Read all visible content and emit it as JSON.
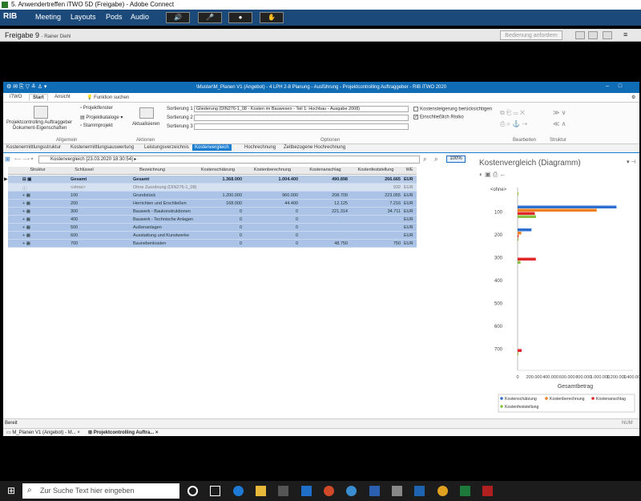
{
  "window_title": "5. Anwendertreffen iTWO 5D (Freigabe) - Adobe Connect",
  "menu": {
    "logo": "RIB",
    "items": [
      "Meeting",
      "Layouts",
      "Pods",
      "Audio"
    ]
  },
  "pod": {
    "title": "Freigabe 9",
    "subtitle": "- Rainer Diehl",
    "request_button": "Bedienung anfordern"
  },
  "app": {
    "title": "\\Muster\\M_Planen V1 (Angebot) - 4 LPH 2-8 Planung - Ausführung - Projektcontrolling Auftraggeber - RIB iTWO 2020",
    "ribbon_tabs": [
      "iTWO",
      "Start",
      "Ansicht"
    ],
    "search_label": "Funktion suchen",
    "ribbon": {
      "projekt_l1": "Projektcontrolling Auftraggeber",
      "projekt_l2": "Dokument-Eigenschaften",
      "projektfenster": "Projektfenster",
      "projektkataloge": "Projektkataloge",
      "stammprojekt": "Stammprojekt",
      "aktualisieren": "Aktualisieren",
      "sort1_label": "Sortierung 1",
      "sort1_value": "Gliederung (DIN276-1_08 - Kosten im Bauwesen - Teil 1: Hochbau - Ausgabe 2008)",
      "sort2_label": "Sortierung 2",
      "sort3_label": "Sortierung 3",
      "opt1": "Kostensteigerung berücksichtigen",
      "opt2": "Einschließlich Risiko",
      "groups": {
        "allgemein": "Allgemein",
        "aktionen": "Aktionen",
        "optionen": "Optionen",
        "bearbeiten": "Bearbeiten",
        "struktur": "Struktur"
      }
    },
    "view_tabs": [
      "Kostenermittlungsstruktur",
      "Kostenermittlungsauswertung",
      "Leistungsverzeichnis",
      "Kostenvergleich",
      "Hochrechnung",
      "Zeitbezogene Hochrechnung"
    ],
    "grid_title": "Kostenvergleich [23.03.2020 18:30:54]",
    "zoom": "100%",
    "columns": [
      "Struktur",
      "Schlüssel",
      "Bezeichnung",
      "Kostenschätzung",
      "Kostenberechnung",
      "Kostenanschlag",
      "Kostenfeststellung",
      "WE"
    ],
    "rows": [
      {
        "key": "Gesamt",
        "name": "Gesamt",
        "ks": "1.368.000",
        "kb": "1.004.400",
        "ka": "490.898",
        "kf": "266.665",
        "we": "EUR",
        "type": "g"
      },
      {
        "key": "<ohne>",
        "name": "Ohne Zuordnung (DIN276-1_08)",
        "ks": "",
        "kb": "",
        "ka": "",
        "kf": "932",
        "we": "EUR",
        "type": "o"
      },
      {
        "key": "100",
        "name": "Grundstück",
        "ks": "1.200.000",
        "kb": "960.000",
        "ka": "208.709",
        "kf": "223.055",
        "we": "EUR",
        "type": ""
      },
      {
        "key": "200",
        "name": "Herrichten und Erschließen",
        "ks": "168.000",
        "kb": "44.400",
        "ka": "12.125",
        "kf": "7.216",
        "we": "EUR",
        "type": ""
      },
      {
        "key": "300",
        "name": "Bauwerk - Baukonstruktionen",
        "ks": "0",
        "kb": "0",
        "ka": "221.314",
        "kf": "34.711",
        "we": "EUR",
        "type": ""
      },
      {
        "key": "400",
        "name": "Bauwerk - Technische Anlagen",
        "ks": "0",
        "kb": "0",
        "ka": "",
        "kf": "",
        "we": "EUR",
        "type": ""
      },
      {
        "key": "500",
        "name": "Außenanlagen",
        "ks": "0",
        "kb": "0",
        "ka": "",
        "kf": "",
        "we": "EUR",
        "type": ""
      },
      {
        "key": "600",
        "name": "Ausstattung und Kunstwerke",
        "ks": "0",
        "kb": "0",
        "ka": "",
        "kf": "",
        "we": "EUR",
        "type": ""
      },
      {
        "key": "700",
        "name": "Baunebenkosten",
        "ks": "0",
        "kb": "0",
        "ka": "48.750",
        "kf": "750",
        "we": "EUR",
        "type": ""
      }
    ],
    "status_text": "Bereit",
    "status_right": "NUM",
    "doc_tabs": [
      "M_Planen V1 (Angebot) - M...",
      "Projektcontrolling Auftra..."
    ]
  },
  "chart_data": {
    "type": "bar",
    "orientation": "horizontal",
    "title": "Kostenvergleich (Diagramm)",
    "xlabel": "Gesamtbetrag",
    "ylabel": "",
    "categories": [
      "<ohne>",
      "100",
      "200",
      "300",
      "400",
      "500",
      "600",
      "700"
    ],
    "tick_labels_y": [
      "<ohne>",
      "100",
      "200",
      "300",
      "400",
      "500",
      "600",
      "700"
    ],
    "tick_labels_x": [
      "0",
      "200.000",
      "400.000",
      "600.000",
      "800.000",
      "1.000.000",
      "1.200.000",
      "1.400.000"
    ],
    "xlim": [
      0,
      1400000
    ],
    "series": [
      {
        "name": "Kostenschätzung",
        "color": "#2f6fd0",
        "values": [
          0,
          1200000,
          168000,
          0,
          0,
          0,
          0,
          0
        ]
      },
      {
        "name": "Kostenberechnung",
        "color": "#f08020",
        "values": [
          0,
          960000,
          44400,
          0,
          0,
          0,
          0,
          0
        ]
      },
      {
        "name": "Kostenanschlag",
        "color": "#e02828",
        "values": [
          0,
          208709,
          12125,
          221314,
          0,
          0,
          0,
          48750
        ]
      },
      {
        "name": "Kostenfeststellung",
        "color": "#88c040",
        "values": [
          932,
          223055,
          7216,
          34711,
          0,
          0,
          0,
          750
        ]
      }
    ],
    "legend_position": "bottom"
  },
  "taskbar": {
    "search_placeholder": "Zur Suche Text hier eingeben"
  }
}
